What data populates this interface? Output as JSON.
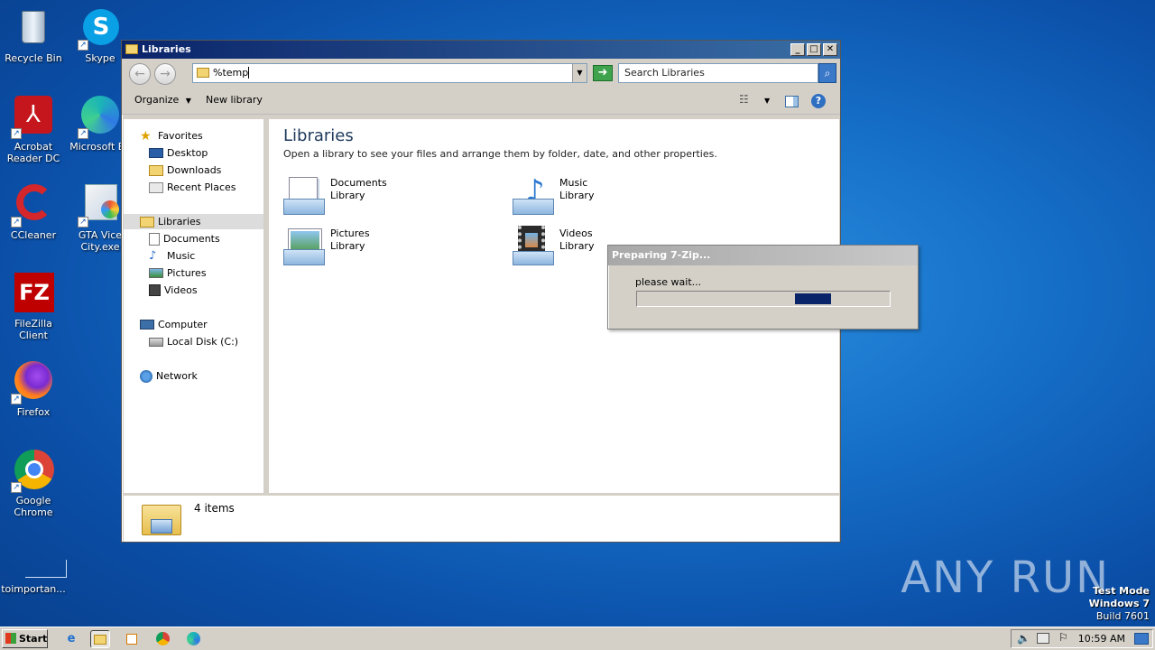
{
  "desktop": {
    "icons": [
      {
        "label": "Recycle Bin",
        "icon": "recycle-bin-icon"
      },
      {
        "label": "Skype",
        "icon": "skype-icon"
      },
      {
        "label": "Acrobat Reader DC",
        "icon": "acrobat-icon"
      },
      {
        "label": "Microsoft Ed",
        "icon": "edge-icon"
      },
      {
        "label": "CCleaner",
        "icon": "ccleaner-icon"
      },
      {
        "label": "GTA Vice City.exe",
        "icon": "gta-icon"
      },
      {
        "label": "FileZilla Client",
        "icon": "filezilla-icon"
      },
      {
        "label": "Firefox",
        "icon": "firefox-icon"
      },
      {
        "label": "Google Chrome",
        "icon": "chrome-icon"
      },
      {
        "label": "toimportan...",
        "icon": "blank-file-icon"
      }
    ],
    "watermark": "ANY RUN",
    "test_mode": {
      "line1": "Test Mode",
      "line2": "Windows 7",
      "line3": "Build 7601"
    }
  },
  "window": {
    "title": "Libraries",
    "address": "%temp",
    "search_placeholder": "Search Libraries",
    "toolbar": {
      "organize": "Organize",
      "new_library": "New library"
    },
    "nav": {
      "favorites": "Favorites",
      "desktop": "Desktop",
      "downloads": "Downloads",
      "recent": "Recent Places",
      "libraries": "Libraries",
      "documents": "Documents",
      "music": "Music",
      "pictures": "Pictures",
      "videos": "Videos",
      "computer": "Computer",
      "local_disk": "Local Disk (C:)",
      "network": "Network"
    },
    "content": {
      "title": "Libraries",
      "subtitle": "Open a library to see your files and arrange them by folder, date, and other properties.",
      "libraries": [
        {
          "name": "Documents",
          "type": "Library"
        },
        {
          "name": "Music",
          "type": "Library"
        },
        {
          "name": "Pictures",
          "type": "Library"
        },
        {
          "name": "Videos",
          "type": "Library"
        }
      ]
    },
    "status": "4 items"
  },
  "dialog": {
    "title": "Preparing 7-Zip...",
    "message": "please wait...",
    "progress_fraction": 0.7
  },
  "taskbar": {
    "start": "Start",
    "clock": "10:59 AM"
  }
}
